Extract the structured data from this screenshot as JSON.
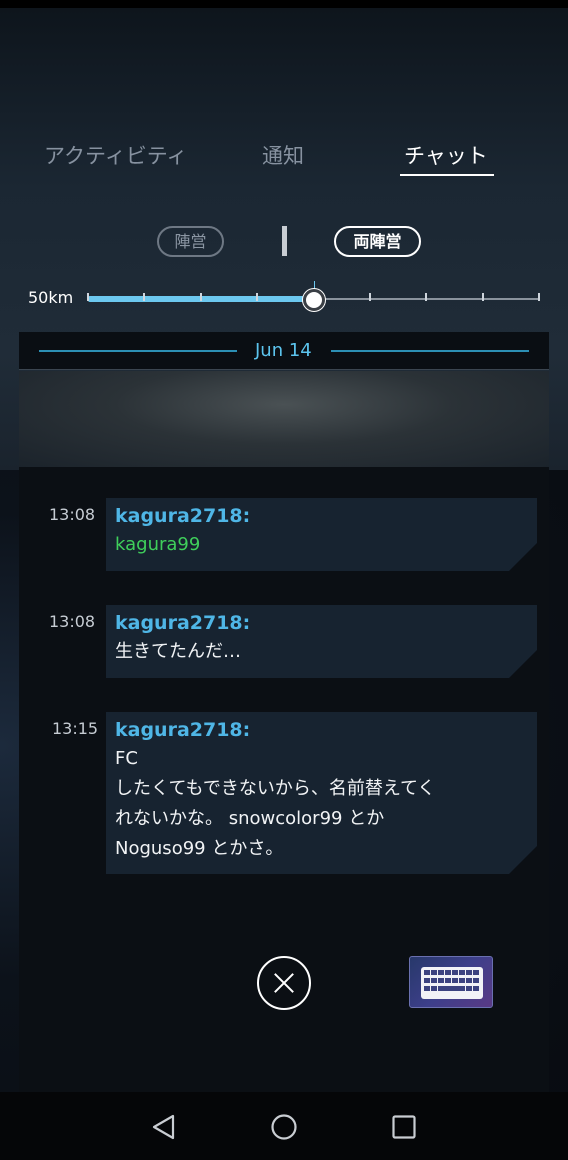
{
  "tabs": [
    {
      "label": "アクティビティ",
      "active": false
    },
    {
      "label": "通知",
      "active": false
    },
    {
      "label": "チャット",
      "active": true
    }
  ],
  "faction_filters": [
    {
      "label": "陣営",
      "selected": false
    },
    {
      "label": "両陣営",
      "selected": true
    }
  ],
  "distance": {
    "label": "50km",
    "selected_step": 4,
    "total_steps": 8
  },
  "date_divider": "Jun 14",
  "messages": [
    {
      "time": "13:08",
      "sender": "kagura2718:",
      "text": "kagura99",
      "text_color": "#3fcf5b"
    },
    {
      "time": "13:08",
      "sender": "kagura2718:",
      "text": "生きてたんだ…",
      "text_color": "#f1f3f5"
    },
    {
      "time": "13:15",
      "sender": "kagura2718:",
      "text": "FC\nしたくてもできないから、名前替えてく\nれないかな。 snowcolor99 とか\nNoguso99 とかさ。",
      "text_color": "#f1f3f5"
    }
  ],
  "colors": {
    "accent": "#5cc4ee",
    "sender": "#4fb6e6",
    "mention": "#3fcf5b"
  },
  "icons": {
    "close": "close-icon",
    "keyboard": "keyboard-icon",
    "back": "back-icon",
    "home": "home-icon",
    "recents": "recents-icon"
  }
}
